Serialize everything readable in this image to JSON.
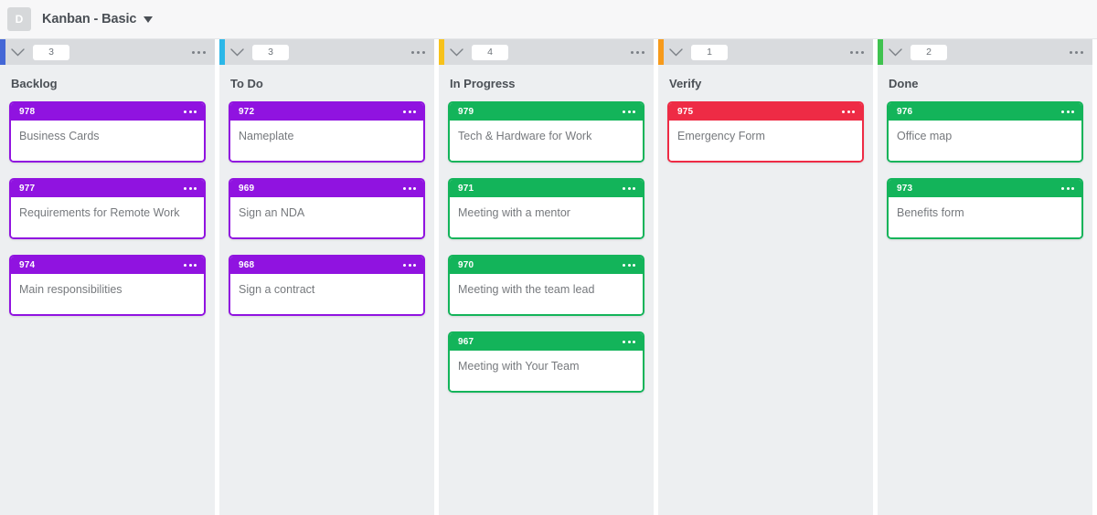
{
  "header": {
    "avatar_letter": "D",
    "title": "Kanban - Basic",
    "caret_icon": "chevron-down-icon"
  },
  "colors": {
    "accent_backlog": "#4467d6",
    "accent_todo": "#2bb7e8",
    "accent_inprogress": "#f7c21b",
    "accent_verify": "#f79a1b",
    "accent_done": "#3fc24f",
    "card_purple": "#9013e0",
    "card_green": "#13b45a",
    "card_red": "#ee2b45",
    "column_bg": "#edeff1",
    "toolbar_bg": "#d9dbde",
    "header_bg": "#f7f7f8"
  },
  "columns": [
    {
      "name": "Backlog",
      "count": "3",
      "accent": "#4467d6",
      "menu_icon": "more-options-icon",
      "collapse_icon": "chevron-down-icon",
      "cards": [
        {
          "id": "978",
          "title": "Business Cards",
          "color": "#9013e0",
          "menu_icon": "more-options-icon"
        },
        {
          "id": "977",
          "title": "Requirements for Remote Work",
          "color": "#9013e0",
          "menu_icon": "more-options-icon"
        },
        {
          "id": "974",
          "title": "Main responsibilities",
          "color": "#9013e0",
          "menu_icon": "more-options-icon"
        }
      ]
    },
    {
      "name": "To Do",
      "count": "3",
      "accent": "#2bb7e8",
      "menu_icon": "more-options-icon",
      "collapse_icon": "chevron-down-icon",
      "cards": [
        {
          "id": "972",
          "title": "Nameplate",
          "color": "#9013e0",
          "menu_icon": "more-options-icon"
        },
        {
          "id": "969",
          "title": "Sign an NDA",
          "color": "#9013e0",
          "menu_icon": "more-options-icon"
        },
        {
          "id": "968",
          "title": "Sign a contract",
          "color": "#9013e0",
          "menu_icon": "more-options-icon"
        }
      ]
    },
    {
      "name": "In Progress",
      "count": "4",
      "accent": "#f7c21b",
      "menu_icon": "more-options-icon",
      "collapse_icon": "chevron-down-icon",
      "cards": [
        {
          "id": "979",
          "title": "Tech & Hardware for Work",
          "color": "#13b45a",
          "menu_icon": "more-options-icon"
        },
        {
          "id": "971",
          "title": "Meeting with a mentor",
          "color": "#13b45a",
          "menu_icon": "more-options-icon"
        },
        {
          "id": "970",
          "title": "Meeting with the team lead",
          "color": "#13b45a",
          "menu_icon": "more-options-icon"
        },
        {
          "id": "967",
          "title": "Meeting with Your Team",
          "color": "#13b45a",
          "menu_icon": "more-options-icon"
        }
      ]
    },
    {
      "name": "Verify",
      "count": "1",
      "accent": "#f79a1b",
      "menu_icon": "more-options-icon",
      "collapse_icon": "chevron-down-icon",
      "cards": [
        {
          "id": "975",
          "title": "Emergency Form",
          "color": "#ee2b45",
          "menu_icon": "more-options-icon"
        }
      ]
    },
    {
      "name": "Done",
      "count": "2",
      "accent": "#3fc24f",
      "menu_icon": "more-options-icon",
      "collapse_icon": "chevron-down-icon",
      "cards": [
        {
          "id": "976",
          "title": "Office map",
          "color": "#13b45a",
          "menu_icon": "more-options-icon"
        },
        {
          "id": "973",
          "title": "Benefits form",
          "color": "#13b45a",
          "menu_icon": "more-options-icon"
        }
      ]
    }
  ]
}
